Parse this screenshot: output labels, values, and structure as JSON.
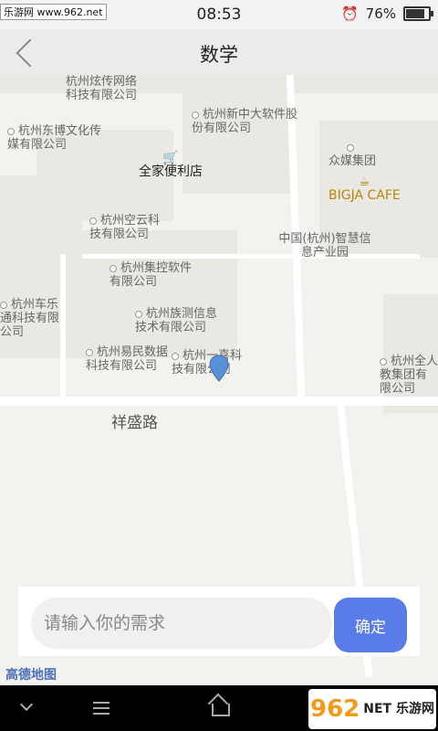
{
  "status_bar": {
    "watermark": "乐游网 www.962.net",
    "time": "08:53",
    "battery_percent": "76%",
    "battery_level": 0.76
  },
  "titlebar": {
    "title": "数学"
  },
  "map": {
    "road_label": "祥盛路",
    "pois": [
      "杭州炫传网络科技有限公司",
      "杭州东博文化传媒有限公司",
      "杭州新中大软件股份有限公司",
      "全家便利店",
      "众媒集团",
      "BIGJA CAFE",
      "杭州空云科技有限公司",
      "中国(杭州)智慧信息产业园",
      "杭州集控软件有限公司",
      "杭州车乐通科技有限公司",
      "杭州族测信息技术有限公司",
      "杭州易民数据科技有限公司",
      "杭州一喜科技有限公司",
      "杭州全人教集团有限公司"
    ],
    "attribution": "高德地图"
  },
  "request": {
    "placeholder": "请输入你的需求",
    "confirm_label": "确定"
  },
  "nav": {
    "logo_number": "962",
    "logo_text": "NET 乐游网"
  },
  "colors": {
    "accent": "#5a7ce8",
    "pin": "#5b8fd6"
  }
}
